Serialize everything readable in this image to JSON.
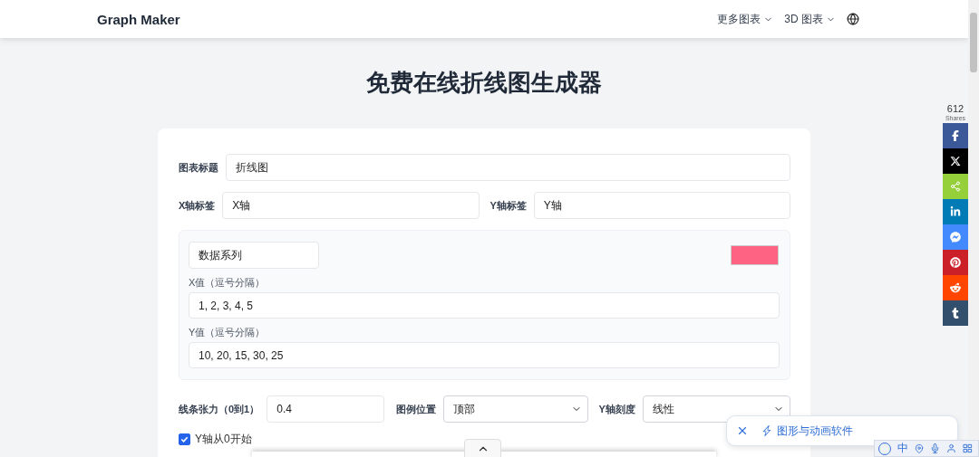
{
  "header": {
    "brand": "Graph Maker",
    "nav": [
      {
        "label": "更多图表",
        "kind": "dropdown"
      },
      {
        "label": "3D 图表",
        "kind": "dropdown"
      }
    ]
  },
  "title": "免费在线折线图生成器",
  "form": {
    "chart_title": {
      "label": "图表标题",
      "value": "折线图"
    },
    "x_label": {
      "label": "X轴标签",
      "value": "X轴"
    },
    "y_label": {
      "label": "Y轴标签",
      "value": "Y轴"
    },
    "series": {
      "name": "数据系列",
      "color": "#ff6384",
      "x_caption": "X值（逗号分隔）",
      "x_values": "1, 2, 3, 4, 5",
      "y_caption": "Y值（逗号分隔）",
      "y_values": "10, 20, 15, 30, 25"
    },
    "tension": {
      "label": "线条张力（0到1）",
      "value": "0.4"
    },
    "legend": {
      "label": "图例位置",
      "value": "顶部"
    },
    "y_scale": {
      "label": "Y轴刻度",
      "value": "线性"
    },
    "begin_at_zero": {
      "label": "Y轴从0开始",
      "checked": true
    }
  },
  "share": {
    "count": "612",
    "caption": "Shares",
    "buttons": [
      {
        "kind": "facebook",
        "color": "#3b5998"
      },
      {
        "kind": "x",
        "color": "#000000"
      },
      {
        "kind": "share",
        "color": "#95d03a"
      },
      {
        "kind": "linkedin",
        "color": "#007bb5"
      },
      {
        "kind": "messenger",
        "color": "#448aff"
      },
      {
        "kind": "pinterest",
        "color": "#cb2027"
      },
      {
        "kind": "reddit",
        "color": "#ff4500"
      },
      {
        "kind": "tumblr",
        "color": "#32506d"
      }
    ]
  },
  "popup": {
    "text": "图形与动画软件"
  },
  "ime": {
    "mode": "中"
  }
}
